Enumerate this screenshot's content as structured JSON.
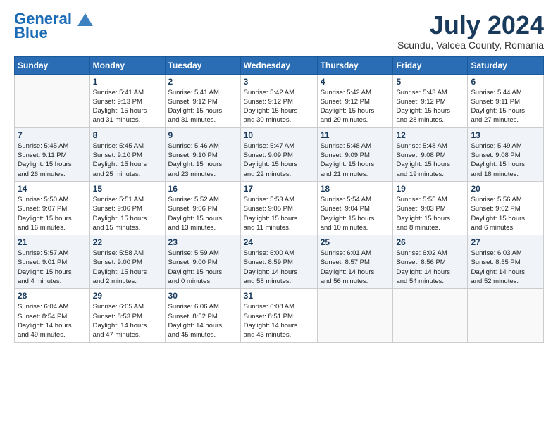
{
  "header": {
    "logo_line1": "General",
    "logo_line2": "Blue",
    "month": "July 2024",
    "location": "Scundu, Valcea County, Romania"
  },
  "weekdays": [
    "Sunday",
    "Monday",
    "Tuesday",
    "Wednesday",
    "Thursday",
    "Friday",
    "Saturday"
  ],
  "weeks": [
    [
      {
        "day": "",
        "info": ""
      },
      {
        "day": "1",
        "info": "Sunrise: 5:41 AM\nSunset: 9:13 PM\nDaylight: 15 hours\nand 31 minutes."
      },
      {
        "day": "2",
        "info": "Sunrise: 5:41 AM\nSunset: 9:12 PM\nDaylight: 15 hours\nand 31 minutes."
      },
      {
        "day": "3",
        "info": "Sunrise: 5:42 AM\nSunset: 9:12 PM\nDaylight: 15 hours\nand 30 minutes."
      },
      {
        "day": "4",
        "info": "Sunrise: 5:42 AM\nSunset: 9:12 PM\nDaylight: 15 hours\nand 29 minutes."
      },
      {
        "day": "5",
        "info": "Sunrise: 5:43 AM\nSunset: 9:12 PM\nDaylight: 15 hours\nand 28 minutes."
      },
      {
        "day": "6",
        "info": "Sunrise: 5:44 AM\nSunset: 9:11 PM\nDaylight: 15 hours\nand 27 minutes."
      }
    ],
    [
      {
        "day": "7",
        "info": "Sunrise: 5:45 AM\nSunset: 9:11 PM\nDaylight: 15 hours\nand 26 minutes."
      },
      {
        "day": "8",
        "info": "Sunrise: 5:45 AM\nSunset: 9:10 PM\nDaylight: 15 hours\nand 25 minutes."
      },
      {
        "day": "9",
        "info": "Sunrise: 5:46 AM\nSunset: 9:10 PM\nDaylight: 15 hours\nand 23 minutes."
      },
      {
        "day": "10",
        "info": "Sunrise: 5:47 AM\nSunset: 9:09 PM\nDaylight: 15 hours\nand 22 minutes."
      },
      {
        "day": "11",
        "info": "Sunrise: 5:48 AM\nSunset: 9:09 PM\nDaylight: 15 hours\nand 21 minutes."
      },
      {
        "day": "12",
        "info": "Sunrise: 5:48 AM\nSunset: 9:08 PM\nDaylight: 15 hours\nand 19 minutes."
      },
      {
        "day": "13",
        "info": "Sunrise: 5:49 AM\nSunset: 9:08 PM\nDaylight: 15 hours\nand 18 minutes."
      }
    ],
    [
      {
        "day": "14",
        "info": "Sunrise: 5:50 AM\nSunset: 9:07 PM\nDaylight: 15 hours\nand 16 minutes."
      },
      {
        "day": "15",
        "info": "Sunrise: 5:51 AM\nSunset: 9:06 PM\nDaylight: 15 hours\nand 15 minutes."
      },
      {
        "day": "16",
        "info": "Sunrise: 5:52 AM\nSunset: 9:06 PM\nDaylight: 15 hours\nand 13 minutes."
      },
      {
        "day": "17",
        "info": "Sunrise: 5:53 AM\nSunset: 9:05 PM\nDaylight: 15 hours\nand 11 minutes."
      },
      {
        "day": "18",
        "info": "Sunrise: 5:54 AM\nSunset: 9:04 PM\nDaylight: 15 hours\nand 10 minutes."
      },
      {
        "day": "19",
        "info": "Sunrise: 5:55 AM\nSunset: 9:03 PM\nDaylight: 15 hours\nand 8 minutes."
      },
      {
        "day": "20",
        "info": "Sunrise: 5:56 AM\nSunset: 9:02 PM\nDaylight: 15 hours\nand 6 minutes."
      }
    ],
    [
      {
        "day": "21",
        "info": "Sunrise: 5:57 AM\nSunset: 9:01 PM\nDaylight: 15 hours\nand 4 minutes."
      },
      {
        "day": "22",
        "info": "Sunrise: 5:58 AM\nSunset: 9:00 PM\nDaylight: 15 hours\nand 2 minutes."
      },
      {
        "day": "23",
        "info": "Sunrise: 5:59 AM\nSunset: 9:00 PM\nDaylight: 15 hours\nand 0 minutes."
      },
      {
        "day": "24",
        "info": "Sunrise: 6:00 AM\nSunset: 8:59 PM\nDaylight: 14 hours\nand 58 minutes."
      },
      {
        "day": "25",
        "info": "Sunrise: 6:01 AM\nSunset: 8:57 PM\nDaylight: 14 hours\nand 56 minutes."
      },
      {
        "day": "26",
        "info": "Sunrise: 6:02 AM\nSunset: 8:56 PM\nDaylight: 14 hours\nand 54 minutes."
      },
      {
        "day": "27",
        "info": "Sunrise: 6:03 AM\nSunset: 8:55 PM\nDaylight: 14 hours\nand 52 minutes."
      }
    ],
    [
      {
        "day": "28",
        "info": "Sunrise: 6:04 AM\nSunset: 8:54 PM\nDaylight: 14 hours\nand 49 minutes."
      },
      {
        "day": "29",
        "info": "Sunrise: 6:05 AM\nSunset: 8:53 PM\nDaylight: 14 hours\nand 47 minutes."
      },
      {
        "day": "30",
        "info": "Sunrise: 6:06 AM\nSunset: 8:52 PM\nDaylight: 14 hours\nand 45 minutes."
      },
      {
        "day": "31",
        "info": "Sunrise: 6:08 AM\nSunset: 8:51 PM\nDaylight: 14 hours\nand 43 minutes."
      },
      {
        "day": "",
        "info": ""
      },
      {
        "day": "",
        "info": ""
      },
      {
        "day": "",
        "info": ""
      }
    ]
  ],
  "row_shades": [
    false,
    true,
    false,
    true,
    false
  ]
}
